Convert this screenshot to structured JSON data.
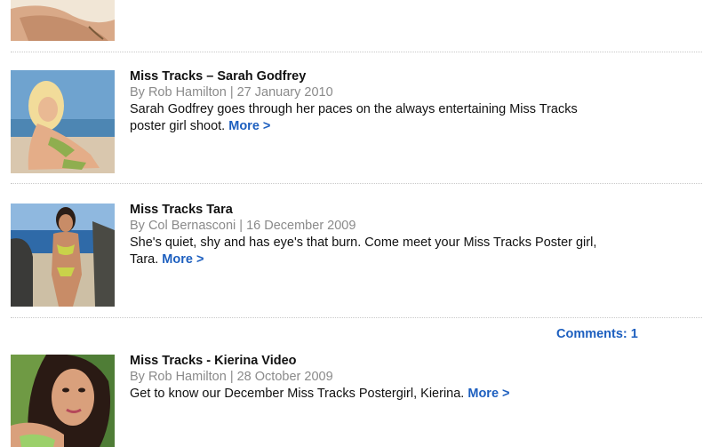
{
  "entries": [
    {
      "title": "Miss Tracks – Sarah Godfrey",
      "meta": "By Rob Hamilton | 27 January 2010",
      "excerpt": "Sarah Godfrey goes through her paces on the always entertaining Miss Tracks poster girl shoot.",
      "more_label": "More >"
    },
    {
      "title": "Miss Tracks Tara",
      "meta": "By Col Bernasconi | 16 December 2009",
      "excerpt": "She's quiet, shy and has eye's that burn. Come meet your Miss Tracks Poster girl, Tara.",
      "more_label": "More >"
    },
    {
      "title": "Miss Tracks - Kierina Video",
      "meta": "By Rob Hamilton | 28 October 2009",
      "excerpt": "Get to know our December Miss Tracks Postergirl, Kierina.",
      "more_label": "More >"
    }
  ],
  "comments": {
    "label": "Comments: 1"
  },
  "colors": {
    "link": "#1d5fbf",
    "meta": "#8a8a8a",
    "divider": "#c9c9c9"
  }
}
